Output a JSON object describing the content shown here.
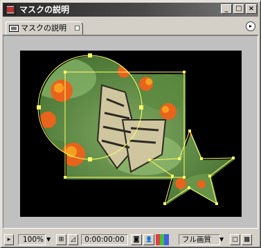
{
  "window": {
    "title": "マスクの説明"
  },
  "titlebar": {
    "minimize_glyph": "_",
    "maximize_glyph": "□",
    "close_glyph": "×"
  },
  "tab": {
    "label": "マスクの説明",
    "menu_glyph": "▸"
  },
  "bottombar": {
    "always_preview_glyph": "▸",
    "zoom": "100%",
    "dropdown_glyph": "▼",
    "safe_area_glyph": "⊞",
    "mask_toggle_glyph": "◿",
    "timecode": "0:00:00:00",
    "snapshot_glyph": "◙",
    "show_snapshot_glyph": "👤",
    "resolution": "フル画質",
    "roi_glyph": "□",
    "transparency_grid_glyph": "▩"
  },
  "colors": {
    "titlebar_dark": "#2a2a2a",
    "window_face": "#d4d0c8",
    "viewer_bg": "#c0c0c0",
    "composition_bg": "#000000",
    "mask_outline": "#ffff66",
    "channel_red": "#e04040",
    "channel_green": "#40c040",
    "channel_blue": "#4060e0"
  },
  "icons": [
    "composition-icon",
    "tab-footage-icon",
    "panel-menu-icon",
    "safe-area-icon",
    "snapshot-icon"
  ]
}
